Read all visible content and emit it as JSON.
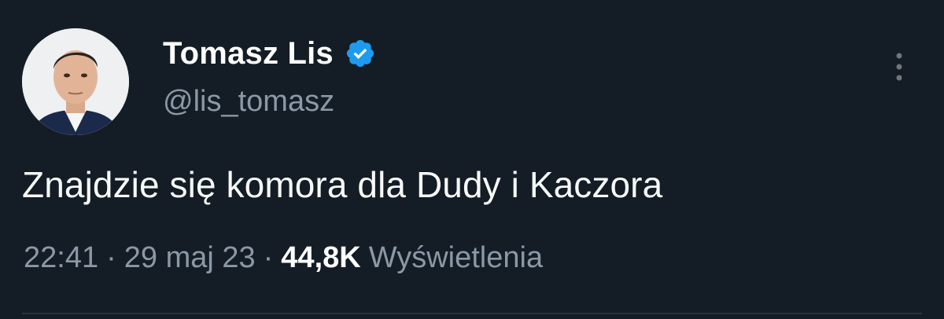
{
  "tweet": {
    "author": {
      "display_name": "Tomasz Lis",
      "handle": "@lis_tomasz",
      "verified": true
    },
    "text": "Znajdzie się komora dla Dudy i Kaczora",
    "time": "22:41",
    "separator": "·",
    "date": "29 maj 23",
    "views_count": "44,8K",
    "views_label": "Wyświetlenia"
  },
  "icons": {
    "verified": "verified-badge-icon",
    "more": "more-vertical-icon"
  },
  "colors": {
    "background": "#141d26",
    "verified_blue": "#1d9bf0",
    "secondary_text": "#8b98a5",
    "primary_text": "#e7e9ea"
  }
}
